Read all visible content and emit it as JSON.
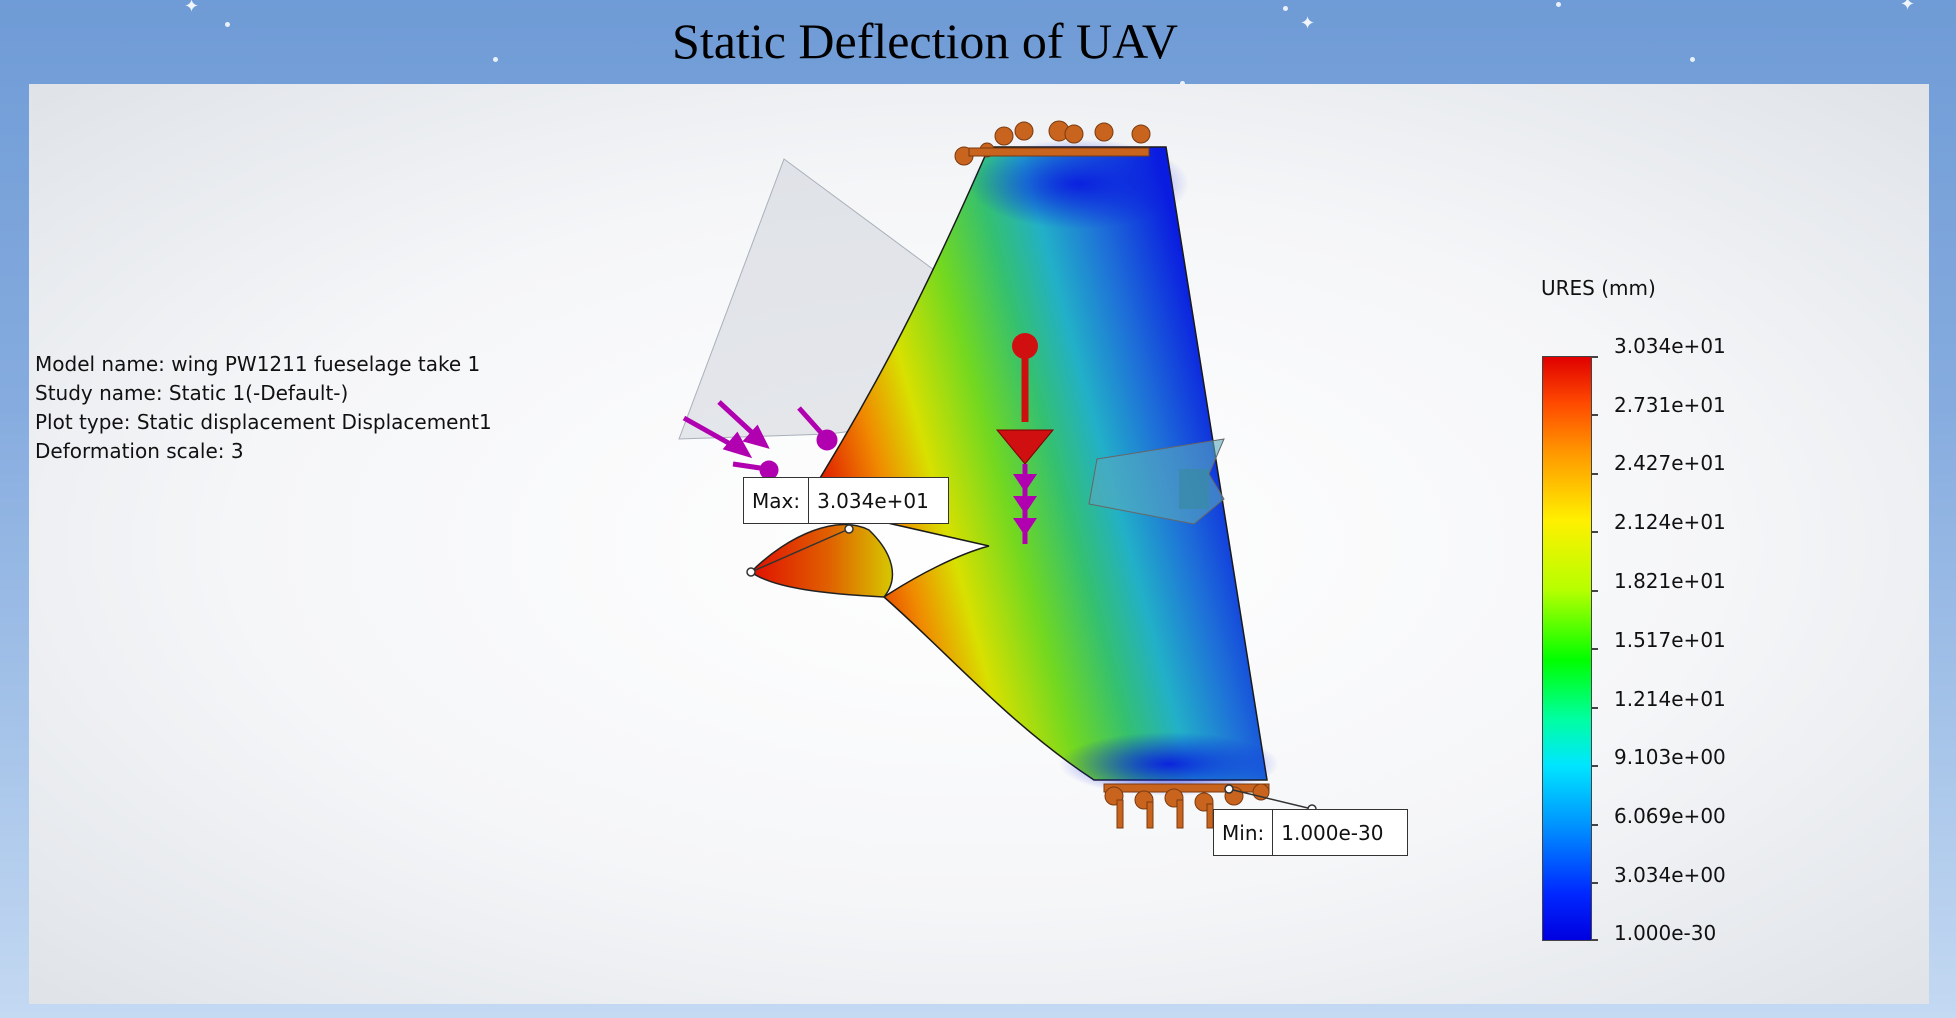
{
  "slide": {
    "title": "Static Deflection of UAV"
  },
  "model_info": {
    "model_name": "Model name: wing PW1211 fueselage take 1",
    "study_name": "Study name: Static 1(-Default-)",
    "plot_type": "Plot type: Static displacement Displacement1",
    "deformation_scale": "Deformation scale: 3"
  },
  "probes": {
    "max": {
      "label": "Max:",
      "value": "3.034e+01"
    },
    "min": {
      "label": "Min:",
      "value": "1.000e-30"
    }
  },
  "legend": {
    "title": "URES (mm)",
    "ticks": [
      "3.034e+01",
      "2.731e+01",
      "2.427e+01",
      "2.124e+01",
      "1.821e+01",
      "1.517e+01",
      "1.214e+01",
      "9.103e+00",
      "6.069e+00",
      "3.034e+00",
      "1.000e-30"
    ]
  },
  "colors": {
    "max": "#e00000",
    "mid": "#00ff00",
    "min": "#0000e0",
    "fixture": "#c8641e",
    "external_load": "#b000b0",
    "gravity": "#cc1010"
  }
}
